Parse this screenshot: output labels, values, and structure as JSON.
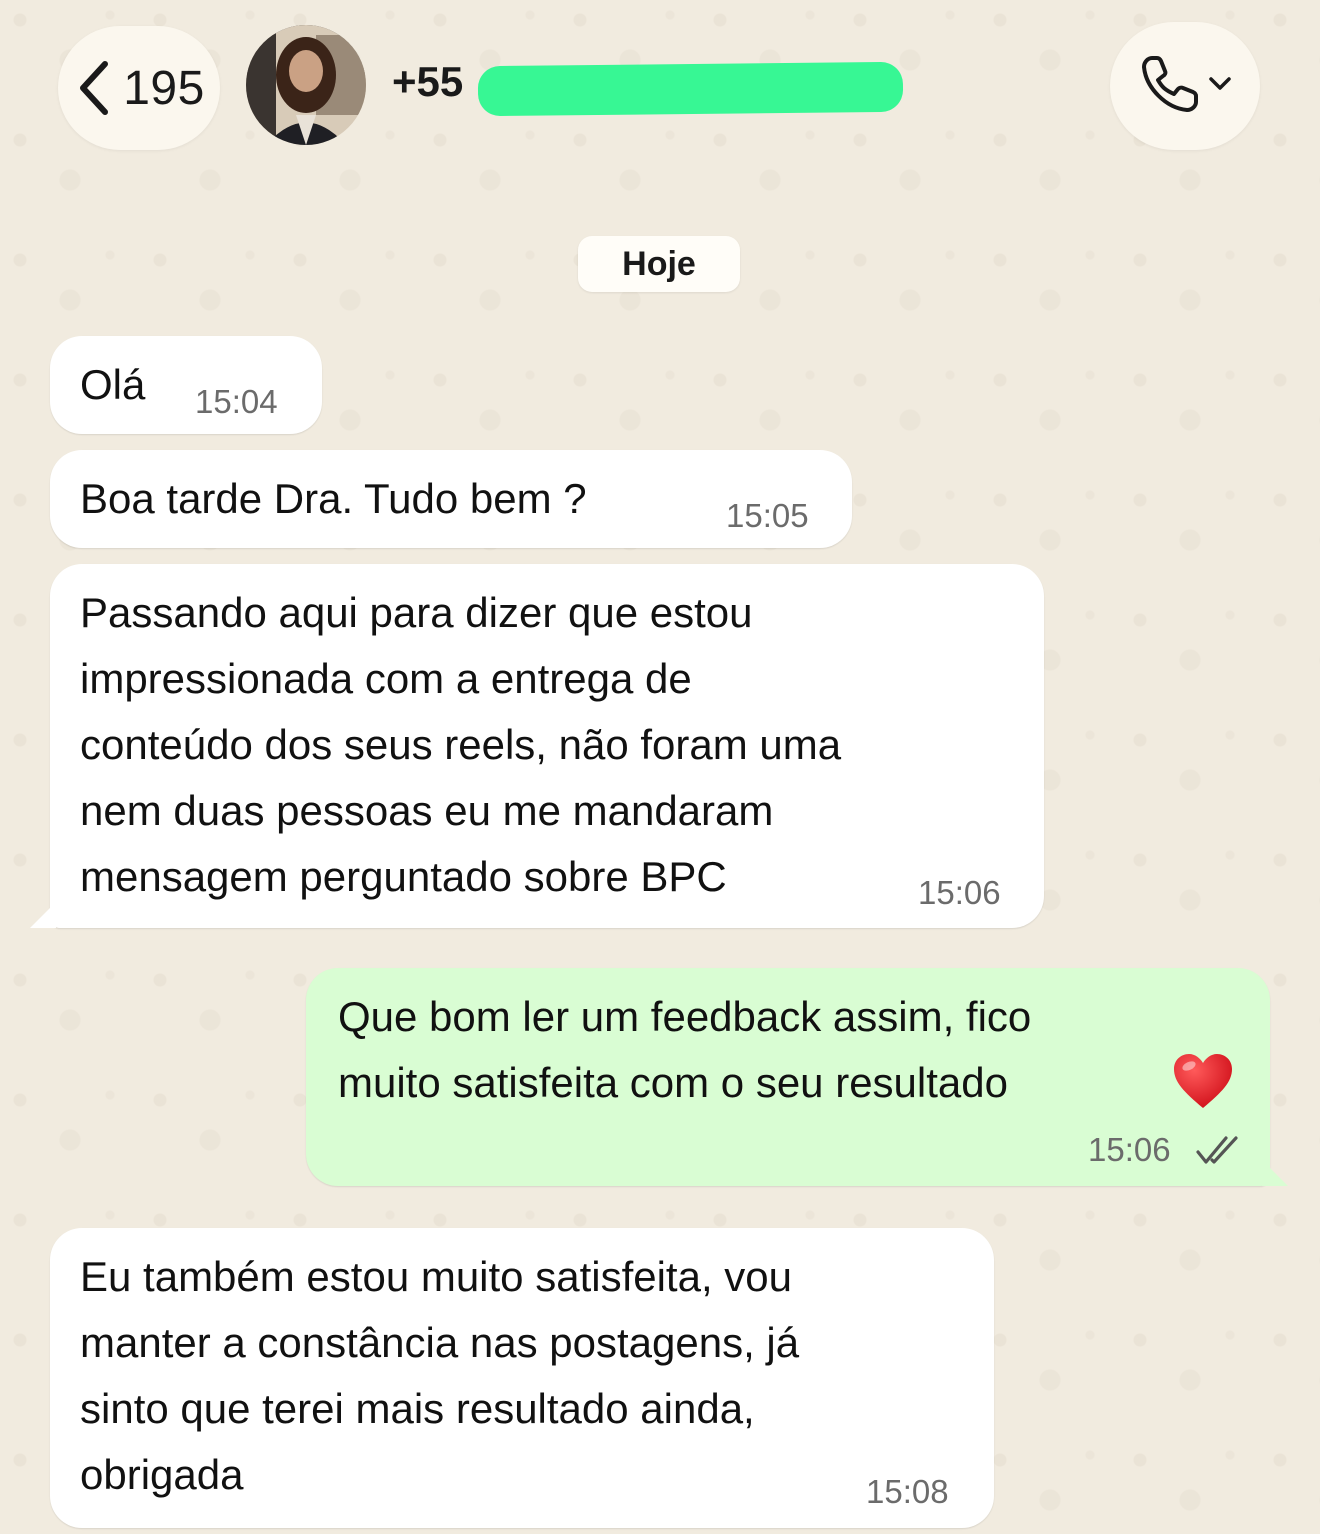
{
  "header": {
    "back_count": "195",
    "contact_name": "+55",
    "avatar": "contact-avatar-photo",
    "back_icon": "chevron-left-icon",
    "call_icon": "phone-icon",
    "call_menu_icon": "chevron-down-icon"
  },
  "date_separator": "Hoje",
  "messages": [
    {
      "direction": "in",
      "text": "Olá",
      "time": "15:04"
    },
    {
      "direction": "in",
      "text": "Boa tarde Dra. Tudo bem ?",
      "time": "15:05"
    },
    {
      "direction": "in",
      "text": "Passando aqui para dizer que estou\nimpressionada com a entrega de\nconteúdo dos seus reels, não foram uma\nnem duas pessoas eu me mandaram\nmensagem perguntado sobre BPC",
      "time": "15:06"
    },
    {
      "direction": "out",
      "text": "Que bom ler um feedback assim, fico\nmuito satisfeita com o seu resultado",
      "emoji": "red-heart",
      "time": "15:06",
      "status": "read-double-check"
    },
    {
      "direction": "in",
      "text": "Eu também estou muito satisfeita, vou\nmanter a constância nas postagens, já\nsinto que terei mais resultado ainda,\nobrigada",
      "time": "15:08"
    }
  ],
  "colors": {
    "background": "#f1ebdf",
    "incoming_bubble": "#ffffff",
    "outgoing_bubble": "#d9fdd3",
    "redaction": "#37f794",
    "timestamp": "#6b6b6b"
  }
}
